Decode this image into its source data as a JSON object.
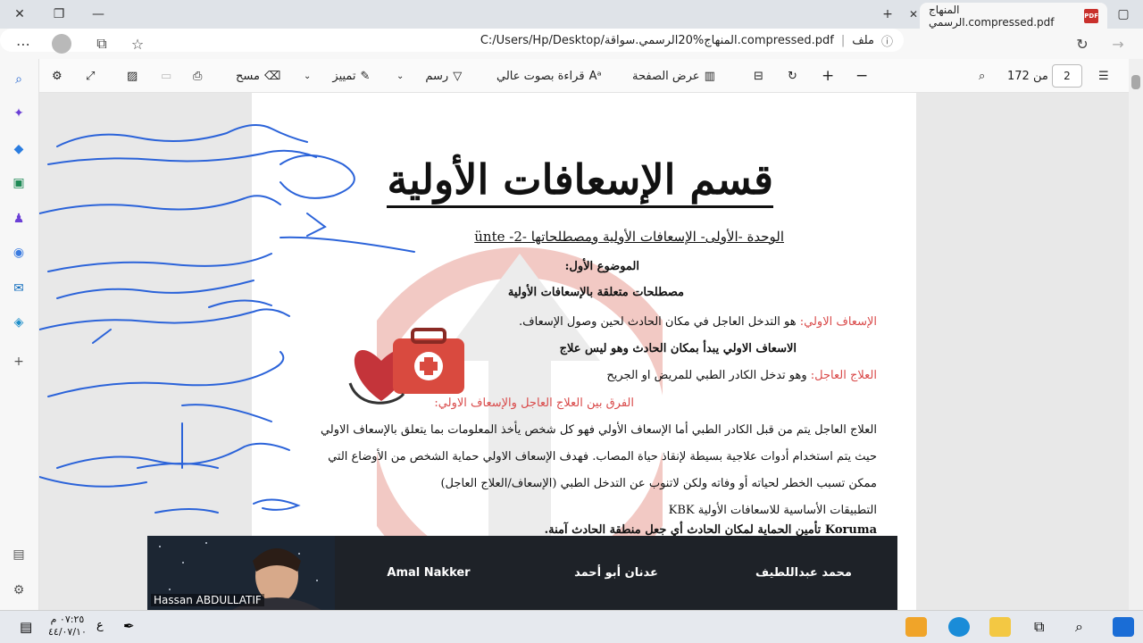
{
  "tab": {
    "title": "المنهاج الرسمي.compressed.pdf",
    "badge": "PDF"
  },
  "address": {
    "label": "ملف",
    "url": "C:/Users/Hp/Desktop/المنهاج%20الرسمي.سواقة.compressed.pdf"
  },
  "toolbar": {
    "page_current": "2",
    "page_of": "من 172",
    "page_view": "عرض الصفحة",
    "read_aloud": "قراءة بصوت عالي",
    "draw": "رسم",
    "highlight": "تمييز",
    "erase": "مسح"
  },
  "pdf": {
    "title": "قسم الإسعافات الأولية",
    "unit": "الوحدة -الأولى-   الإسعافات الأولية ومصطلحاتها -2- ünte",
    "topic": "الموضوع الأول:",
    "terms": "مصطلحات متعلقة بالإسعافات الأولية",
    "def1_label": "الإسعاف الاولي:",
    "def1_text": "هو التدخل العاجل في مكان الحادث لحين وصول الإسعاف.",
    "def1_bold": "الاسعاف الاولي يبدأ بمكان الحادث وهو ليس علاج",
    "def2_label": "العلاج العاجل:",
    "def2_text": "وهو تدخل الكادر الطبي للمريض او الجريح",
    "diff": "الفرق بين العلاج العاجل والإسعاف الاولي:",
    "para1": "العلاج العاجل يتم من قبل الكادر الطبي أما الإسعاف الأولي فهو كل شخص يأخذ المعلومات بما يتعلق بالإسعاف الاولي",
    "para2": "حيث يتم استخدام أدوات علاجية بسيطة لإنقاذ حياة المصاب. فهدف الإسعاف الاولي حماية الشخص من الأوضاع التي",
    "para3": "ممكن تسبب الخطر لحياته أو وفاته ولكن لاتنوب عن التدخل الطبي (الإسعاف/العلاج العاجل)",
    "apps": "التطبيقات الأساسية للاسعافات الأولية KBK",
    "koruma": "Koruma تأمين الحماية لمكان الحادث أي جعل منطقة الحادث آمنة."
  },
  "video": {
    "tiles": [
      {
        "name": "Hassan ABDULLATIF"
      },
      {
        "name": "Amal Nakker"
      },
      {
        "name": "عدنان أبو أحمد"
      },
      {
        "name": "محمد عبداللطيف"
      }
    ]
  },
  "taskbar": {
    "time": "٠٧:٢٥ م",
    "date": "٤٤/٠٧/١٠",
    "lang": "ع"
  },
  "colors": {
    "accent_red": "#d94a4a",
    "video_bg": "#1e2228",
    "ink_blue": "#2b63d9"
  }
}
